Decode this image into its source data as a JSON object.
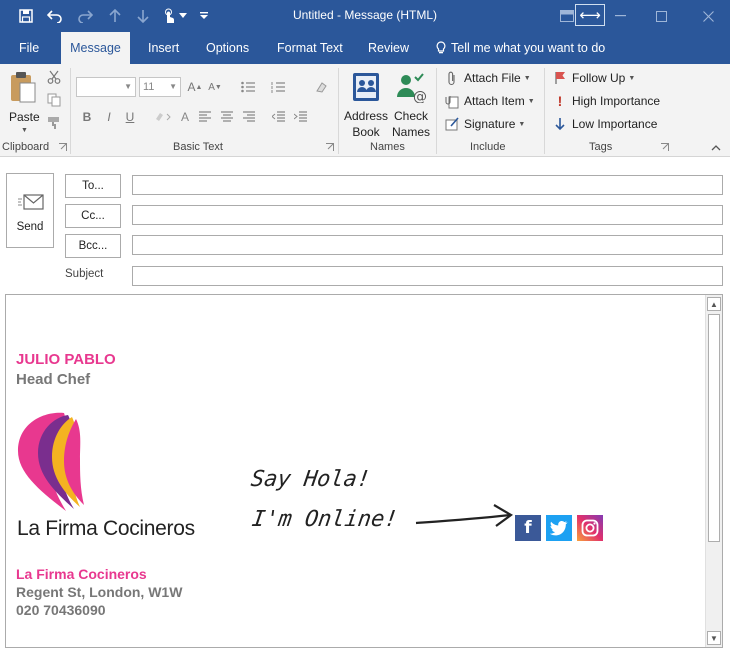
{
  "window": {
    "title": "Untitled - Message (HTML)"
  },
  "tabs": [
    "File",
    "Message",
    "Insert",
    "Options",
    "Format Text",
    "Review"
  ],
  "tell_me": "Tell me what you want to do",
  "ribbon": {
    "clipboard": {
      "paste": "Paste",
      "label": "Clipboard"
    },
    "basic_text": {
      "font_size": "11",
      "label": "Basic Text"
    },
    "names": {
      "address_book_1": "Address",
      "address_book_2": "Book",
      "check_names_1": "Check",
      "check_names_2": "Names",
      "label": "Names"
    },
    "include": {
      "attach_file": "Attach File",
      "attach_item": "Attach Item",
      "signature": "Signature",
      "label": "Include"
    },
    "tags": {
      "follow_up": "Follow Up",
      "high_importance": "High Importance",
      "low_importance": "Low Importance",
      "label": "Tags"
    }
  },
  "header": {
    "send": "Send",
    "to": "To...",
    "cc": "Cc...",
    "bcc": "Bcc...",
    "subject": "Subject"
  },
  "signature": {
    "name": "JULIO PABLO",
    "title": "Head Chef",
    "logo_text": "La Firma Cocineros",
    "handwriting_1": "Say Hola!",
    "handwriting_2": "I'm Online!",
    "company": "La Firma Cocineros",
    "address": "Regent St, London, W1W",
    "phone": "020 70436090"
  },
  "colors": {
    "brand_blue": "#2b579a",
    "signature_pink": "#e8388f",
    "signature_gray": "#777777",
    "facebook": "#3b5998",
    "twitter": "#1da1f2"
  }
}
